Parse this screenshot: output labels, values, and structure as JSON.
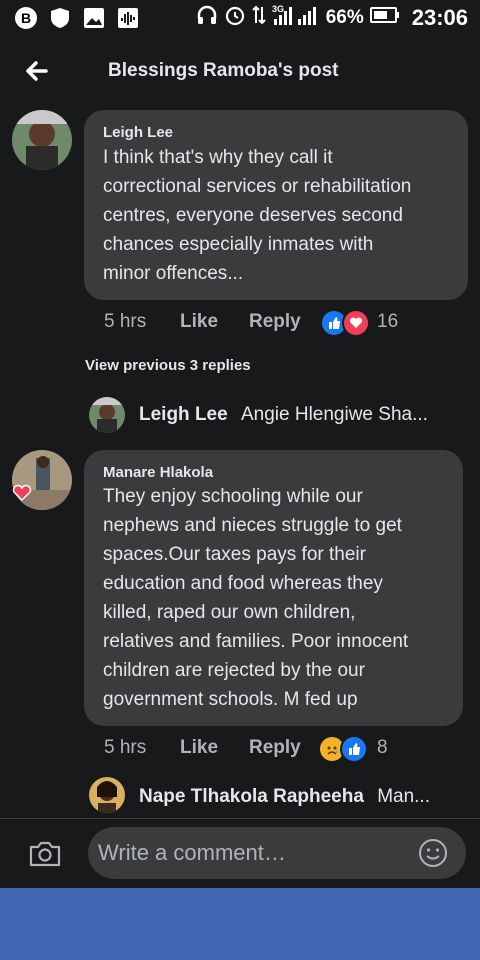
{
  "status": {
    "battery": "66%",
    "time": "23:06",
    "network": "3G"
  },
  "header": {
    "title": "Blessings Ramoba's post"
  },
  "comments": [
    {
      "author": "Leigh Lee",
      "text": "I think that's why they call it\ncorrectional services or rehabilitation\ncentres, everyone deserves second\nchances especially inmates with\nminor offences...",
      "time": "5 hrs",
      "like": "Like",
      "reply": "Reply",
      "reaction_count": "16"
    },
    {
      "author": "Manare Hlakola",
      "text": "They enjoy schooling while our\nnephews and nieces struggle to get\nspaces.Our taxes pays for their\neducation and food whereas they\nkilled, raped our own children,\nrelatives and families. Poor innocent\nchildren are rejected by the our\ngovernment schools. M fed up",
      "time": "5 hrs",
      "like": "Like",
      "reply": "Reply",
      "reaction_count": "8"
    }
  ],
  "view_previous": "View previous 3 replies",
  "replies": [
    {
      "author": "Leigh Lee",
      "preview": "Angie Hlengiwe Sha..."
    },
    {
      "author": "Nape Tlhakola Rapheeha",
      "preview": "Man..."
    }
  ],
  "composer": {
    "placeholder": "Write a comment…"
  },
  "colors": {
    "background": "#18191a",
    "bubble": "#3a3b3c",
    "like_blue": "#1877f2",
    "love_red": "#f33e58",
    "nav_blue": "#4267b2"
  }
}
